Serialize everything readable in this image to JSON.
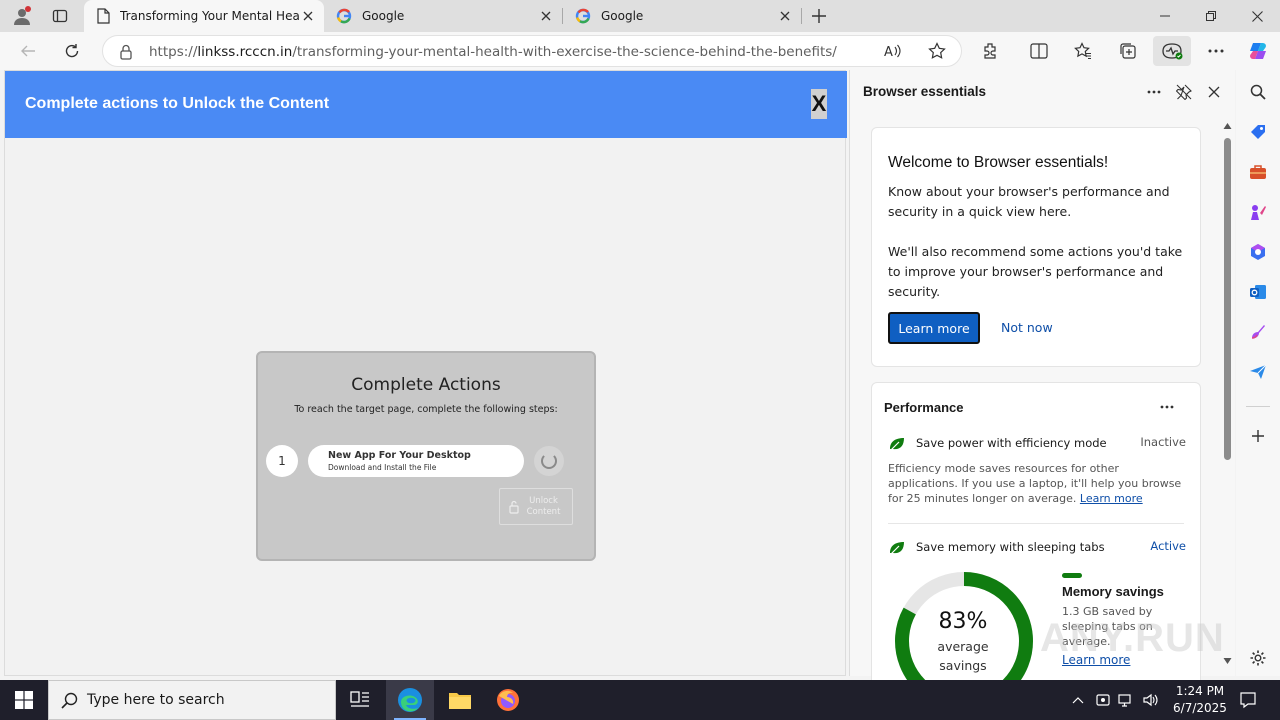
{
  "browser": {
    "tabs": [
      {
        "title": "Transforming Your Mental Health",
        "active": true
      },
      {
        "title": "Google",
        "active": false
      },
      {
        "title": "Google",
        "active": false
      }
    ],
    "url_scheme": "https://",
    "url_host": "linkss.rcccn.in",
    "url_path": "/transforming-your-mental-health-with-exercise-the-science-behind-the-benefits/"
  },
  "page": {
    "banner_title": "Complete actions to Unlock the Content",
    "banner_close": "X",
    "modal": {
      "title": "Complete Actions",
      "subtitle": "To reach the target page, complete the following steps:",
      "step_number": "1",
      "step_name": "New App For Your Desktop",
      "step_desc": "Download and Install the File",
      "unlock_label": "Unlock Content"
    }
  },
  "panel": {
    "title": "Browser essentials",
    "welcome": {
      "title": "Welcome to Browser essentials!",
      "p1": "Know about your browser's performance and security in a quick view here.",
      "p2": "We'll also recommend some actions you'd take to improve your browser's performance and security.",
      "learn_more": "Learn more",
      "not_now": "Not now"
    },
    "performance": {
      "title": "Performance",
      "efficiency_label": "Save power with efficiency mode",
      "efficiency_state": "Inactive",
      "efficiency_desc": "Efficiency mode saves resources for other applications. If you use a laptop, it'll help you browse for 25 minutes longer on average.",
      "efficiency_link": "Learn more",
      "sleeping_label": "Save memory with sleeping tabs",
      "sleeping_state": "Active",
      "gauge_value": 83,
      "gauge_pct": "83%",
      "gauge_label1": "average",
      "gauge_label2": "savings",
      "memory_title": "Memory savings",
      "memory_desc": "1.3 GB saved by sleeping tabs on average.",
      "memory_link": "Learn more"
    },
    "watermark": "ANY.RUN"
  },
  "taskbar": {
    "search_placeholder": "Type here to search",
    "time": "1:24 PM",
    "date": "6/7/2025"
  },
  "colors": {
    "banner": "#4a8af4",
    "accent_green": "#107c10",
    "link_blue": "#0f4fa8",
    "primary_button": "#0f5fc2"
  }
}
